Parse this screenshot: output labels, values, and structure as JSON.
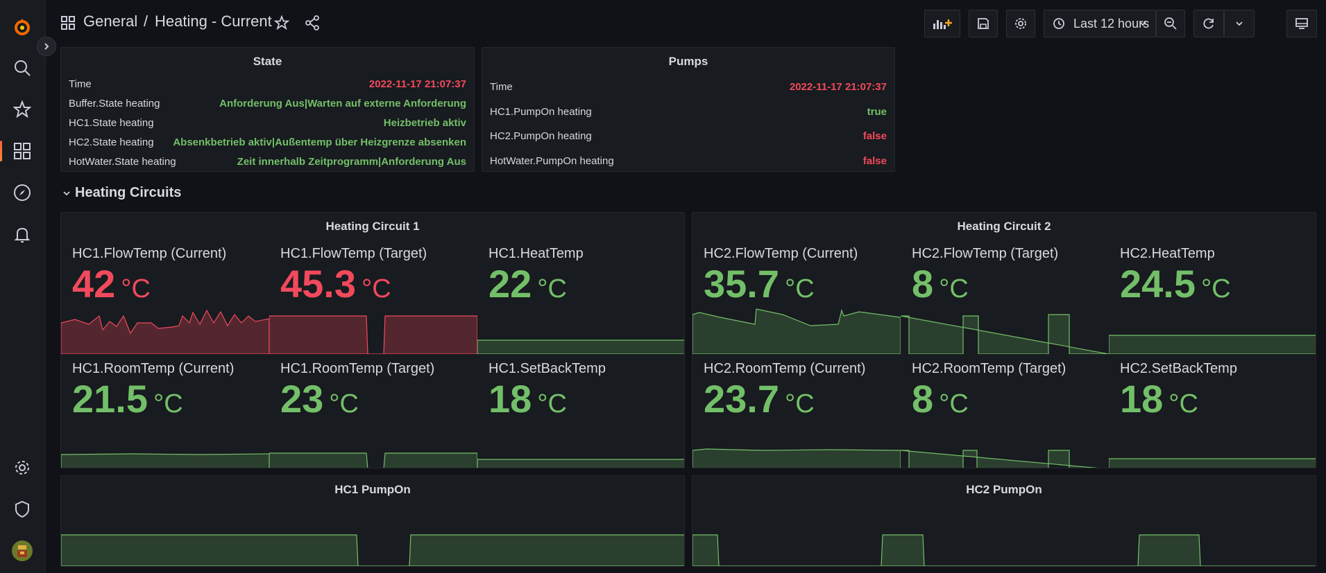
{
  "breadcrumb": {
    "folder": "General",
    "separator": "/",
    "dashboard": "Heating - Current"
  },
  "time_picker": {
    "label": "Last 12 hours"
  },
  "colors": {
    "red": "#f2495c",
    "green": "#73bf69",
    "bg": "#111217",
    "panel": "#181b1f"
  },
  "state_panel": {
    "title": "State",
    "rows": [
      {
        "key": "Time",
        "value": "2022-11-17 21:07:37",
        "status": "red"
      },
      {
        "key": "Buffer.State heating",
        "value": "Anforderung Aus|Warten auf externe Anforderung",
        "status": "green"
      },
      {
        "key": "HC1.State heating",
        "value": "Heizbetrieb aktiv",
        "status": "green"
      },
      {
        "key": "HC2.State heating",
        "value": "Absenkbetrieb aktiv|Außentemp über Heizgrenze absenken",
        "status": "green"
      },
      {
        "key": "HotWater.State heating",
        "value": "Zeit innerhalb Zeitprogramm|Anforderung Aus",
        "status": "green"
      }
    ]
  },
  "pumps_panel": {
    "title": "Pumps",
    "rows": [
      {
        "key": "Time",
        "value": "2022-11-17 21:07:37",
        "status": "red"
      },
      {
        "key": "HC1.PumpOn heating",
        "value": "true",
        "status": "green"
      },
      {
        "key": "HC2.PumpOn heating",
        "value": "false",
        "status": "red"
      },
      {
        "key": "HotWater.PumpOn heating",
        "value": "false",
        "status": "red"
      }
    ]
  },
  "row": {
    "title": "Heating Circuits"
  },
  "hc1": {
    "title": "Heating Circuit 1",
    "stats": [
      {
        "label": "HC1.FlowTemp (Current)",
        "value": "42",
        "unit": "°C",
        "color": "red"
      },
      {
        "label": "HC1.FlowTemp (Target)",
        "value": "45.3",
        "unit": "°C",
        "color": "red"
      },
      {
        "label": "HC1.HeatTemp",
        "value": "22",
        "unit": "°C",
        "color": "green"
      },
      {
        "label": "HC1.RoomTemp (Current)",
        "value": "21.5",
        "unit": "°C",
        "color": "green"
      },
      {
        "label": "HC1.RoomTemp (Target)",
        "value": "23",
        "unit": "°C",
        "color": "green"
      },
      {
        "label": "HC1.SetBackTemp",
        "value": "18",
        "unit": "°C",
        "color": "green"
      }
    ]
  },
  "hc2": {
    "title": "Heating Circuit 2",
    "stats": [
      {
        "label": "HC2.FlowTemp (Current)",
        "value": "35.7",
        "unit": "°C",
        "color": "green"
      },
      {
        "label": "HC2.FlowTemp (Target)",
        "value": "8",
        "unit": "°C",
        "color": "green"
      },
      {
        "label": "HC2.HeatTemp",
        "value": "24.5",
        "unit": "°C",
        "color": "green"
      },
      {
        "label": "HC2.RoomTemp (Current)",
        "value": "23.7",
        "unit": "°C",
        "color": "green"
      },
      {
        "label": "HC2.RoomTemp (Target)",
        "value": "8",
        "unit": "°C",
        "color": "green"
      },
      {
        "label": "HC2.SetBackTemp",
        "value": "18",
        "unit": "°C",
        "color": "green"
      }
    ]
  },
  "pump_charts": [
    {
      "title": "HC1 PumpOn"
    },
    {
      "title": "HC2 PumpOn"
    }
  ]
}
